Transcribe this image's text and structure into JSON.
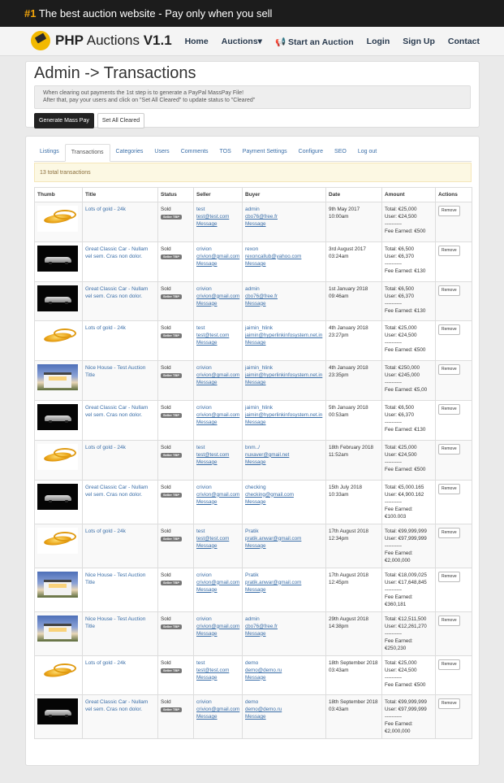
{
  "topbar": {
    "hash": "#1",
    "text": " The best auction website - Pay only when you sell"
  },
  "brand": {
    "name_bold": "PHP",
    "name": " Auctions ",
    "version": "V1.1"
  },
  "nav": [
    "Home",
    "Auctions▾",
    "📢 Start an Auction",
    "Login",
    "Sign Up",
    "Contact"
  ],
  "page": {
    "title": "Admin -> Transactions",
    "note_line1": "When clearing out payments the 1st step is to generate a PayPal MassPay File!",
    "note_line2": "After that, pay your users and click on \"Set All Cleared\" to update status to \"Cleared\"",
    "btn_generate": "Generate Mass Pay",
    "btn_cleared": "Set All Cleared"
  },
  "tabs": [
    "Listings",
    "Transactions",
    "Categories",
    "Users",
    "Comments",
    "TOS",
    "Payment Settings",
    "Configure",
    "SEO",
    "Log out"
  ],
  "active_tab": "Transactions",
  "alert": "13 total transactions",
  "table": {
    "headers": [
      "Thumb",
      "Title",
      "Status",
      "Seller",
      "Buyer",
      "Date",
      "Amount",
      "Actions"
    ],
    "badge": "Seller TBP",
    "message_label": "Message",
    "remove_label": "Remove",
    "rows": [
      {
        "thumb": "gold",
        "title": "Lots of gold - 24k",
        "status": "Sold",
        "seller": "test",
        "seller_email": "test@test.com",
        "buyer": "admin",
        "buyer_email": "cbo76@free.fr",
        "date": "9th May 2017 10:00am",
        "total": "Total: €25,000",
        "user": "User: €24,500",
        "fee": "Fee Earned: €500"
      },
      {
        "thumb": "car",
        "title": "Great Classic Car - Nullam vel sem. Cras non dolor.",
        "status": "Sold",
        "seller": "crivion",
        "seller_email": "crivion@gmail.com",
        "buyer": "rexon",
        "buyer_email": "rexoncallub@yahoo.com",
        "date": "3rd August 2017 03:24am",
        "total": "Total: €6,500",
        "user": "User: €6,370",
        "fee": "Fee Earned: €130"
      },
      {
        "thumb": "car",
        "title": "Great Classic Car - Nullam vel sem. Cras non dolor.",
        "status": "Sold",
        "seller": "crivion",
        "seller_email": "crivion@gmail.com",
        "buyer": "admin",
        "buyer_email": "cbo76@free.fr",
        "date": "1st January 2018 09:46am",
        "total": "Total: €6,500",
        "user": "User: €6,370",
        "fee": "Fee Earned: €130"
      },
      {
        "thumb": "gold",
        "title": "Lots of gold - 24k",
        "status": "Sold",
        "seller": "test",
        "seller_email": "test@test.com",
        "buyer": "jaimin_hlink",
        "buyer_email": "jaimin@hyperlinkinfosystem.net.in",
        "date": "4th January 2018 23:27pm",
        "total": "Total: €25,000",
        "user": "User: €24,500",
        "fee": "Fee Earned: €500"
      },
      {
        "thumb": "house",
        "title": "Nice House - Test Auction Title",
        "status": "Sold",
        "seller": "crivion",
        "seller_email": "crivion@gmail.com",
        "buyer": "jaimin_hlink",
        "buyer_email": "jaimin@hyperlinkinfosystem.net.in",
        "date": "4th January 2018 23:35pm",
        "total": "Total: €250,000",
        "user": "User: €245,000",
        "fee": "Fee Earned: €5,00"
      },
      {
        "thumb": "car",
        "title": "Great Classic Car - Nullam vel sem. Cras non dolor.",
        "status": "Sold",
        "seller": "crivion",
        "seller_email": "crivion@gmail.com",
        "buyer": "jaimin_hlink",
        "buyer_email": "jaimin@hyperlinkinfosystem.net.in",
        "date": "5th January 2018 00:53am",
        "total": "Total: €6,500",
        "user": "User: €6,370",
        "fee": "Fee Earned: €130"
      },
      {
        "thumb": "gold",
        "title": "Lots of gold - 24k",
        "status": "Sold",
        "seller": "test",
        "seller_email": "test@test.com",
        "buyer": "bnm../",
        "buyer_email": "nuxaver@gmail.net",
        "date": "18th February 2018 11:52am",
        "total": "Total: €25,000",
        "user": "User: €24,500",
        "fee": "Fee Earned: €500"
      },
      {
        "thumb": "car",
        "title": "Great Classic Car - Nullam vel sem. Cras non dolor.",
        "status": "Sold",
        "seller": "crivion",
        "seller_email": "crivion@gmail.com",
        "buyer": "checking",
        "buyer_email": "checking@gmail.com",
        "date": "15th July 2018 10:33am",
        "total": "Total: €5,000.165",
        "user": "User: €4,900.162",
        "fee": "Fee Earned: €100.003"
      },
      {
        "thumb": "gold",
        "title": "Lots of gold - 24k",
        "status": "Sold",
        "seller": "test",
        "seller_email": "test@test.com",
        "buyer": "Pratik",
        "buyer_email": "pratik.anwar@gmail.com",
        "date": "17th August 2018 12:34pm",
        "total": "Total: €99,999,999",
        "user": "User: €97,999,999",
        "fee": "Fee Earned: €2,000,000"
      },
      {
        "thumb": "house",
        "title": "Nice House - Test Auction Title",
        "status": "Sold",
        "seller": "crivion",
        "seller_email": "crivion@gmail.com",
        "buyer": "Pratik",
        "buyer_email": "pratik.anwar@gmail.com",
        "date": "17th August 2018 12:45pm",
        "total": "Total: €18,009,025",
        "user": "User: €17,648,845",
        "fee": "Fee Earned: €360,181"
      },
      {
        "thumb": "house",
        "title": "Nice House - Test Auction Title",
        "status": "Sold",
        "seller": "crivion",
        "seller_email": "crivion@gmail.com",
        "buyer": "admin",
        "buyer_email": "cbo76@free.fr",
        "date": "29th August 2018 14:38pm",
        "total": "Total: €12,511,500",
        "user": "User: €12,261,270",
        "fee": "Fee Earned: €250,230"
      },
      {
        "thumb": "gold",
        "title": "Lots of gold - 24k",
        "status": "Sold",
        "seller": "test",
        "seller_email": "test@test.com",
        "buyer": "demo",
        "buyer_email": "demo@demo.ru",
        "date": "18th September 2018 03:43am",
        "total": "Total: €25,000",
        "user": "User: €24,500",
        "fee": "Fee Earned: €500"
      },
      {
        "thumb": "car",
        "title": "Great Classic Car - Nullam vel sem. Cras non dolor.",
        "status": "Sold",
        "seller": "crivion",
        "seller_email": "crivion@gmail.com",
        "buyer": "demo",
        "buyer_email": "demo@demo.ru",
        "date": "18th September 2018 03:43am",
        "total": "Total: €99,999,999",
        "user": "User: €97,999,999",
        "fee": "Fee Earned: €2,000,000"
      }
    ]
  }
}
